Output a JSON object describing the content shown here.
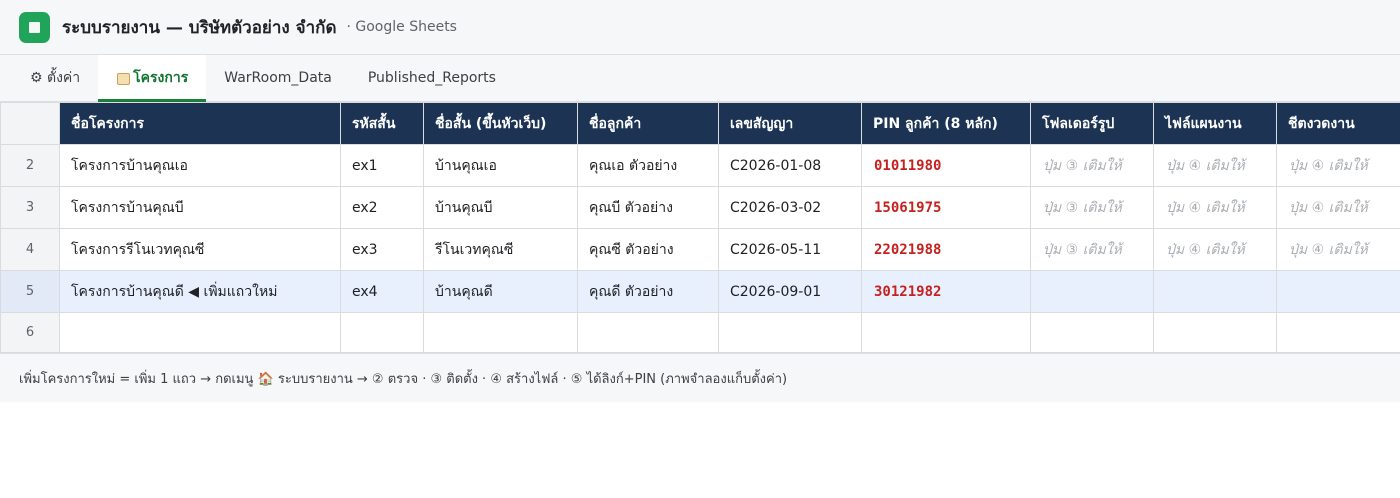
{
  "window": {
    "title": "ระบบรายงาน — บริษัทตัวอย่าง จำกัด",
    "app": "· Google Sheets",
    "brand_color": "#20a45a"
  },
  "tabs": [
    {
      "label": "⚙ ตั้งค่า",
      "active": false
    },
    {
      "label": "โครงการ",
      "icon": "scroll-icon",
      "active": true
    },
    {
      "label": "WarRoom_Data",
      "active": false
    },
    {
      "label": "Published_Reports",
      "active": false
    }
  ],
  "table": {
    "header_color": "#1c3354",
    "columns": [
      "ชื่อโครงการ",
      "รหัสสั้น",
      "ชื่อสั้น (ขึ้นหัวเว็บ)",
      "ชื่อลูกค้า",
      "เลขสัญญา",
      "PIN ลูกค้า (8 หลัก)",
      "โฟลเดอร์รูป",
      "ไฟล์แผนงาน",
      "ชีตงวดงาน"
    ],
    "rows": [
      {
        "num": "2",
        "cells": [
          "โครงการบ้านคุณเอ",
          "ex1",
          "บ้านคุณเอ",
          "คุณเอ ตัวอย่าง",
          "C2026-01-08",
          "01011980",
          "ปุ่ม ③ เติมให้",
          "ปุ่ม ④ เติมให้",
          "ปุ่ม ④ เติมให้"
        ]
      },
      {
        "num": "3",
        "cells": [
          "โครงการบ้านคุณบี",
          "ex2",
          "บ้านคุณบี",
          "คุณบี ตัวอย่าง",
          "C2026-03-02",
          "15061975",
          "ปุ่ม ③ เติมให้",
          "ปุ่ม ④ เติมให้",
          "ปุ่ม ④ เติมให้"
        ]
      },
      {
        "num": "4",
        "cells": [
          "โครงการรีโนเวทคุณซี",
          "ex3",
          "รีโนเวทคุณซี",
          "คุณซี ตัวอย่าง",
          "C2026-05-11",
          "22021988",
          "ปุ่ม ③ เติมให้",
          "ปุ่ม ④ เติมให้",
          "ปุ่ม ④ เติมให้"
        ]
      },
      {
        "num": "5",
        "cells": [
          "โครงการบ้านคุณดี ◀ เพิ่มแถวใหม่",
          "ex4",
          "บ้านคุณดี",
          "คุณดี ตัวอย่าง",
          "C2026-09-01",
          "30121982",
          "",
          "",
          ""
        ]
      },
      {
        "num": "6",
        "cells": [
          "",
          "",
          "",
          "",
          "",
          "",
          "",
          "",
          ""
        ]
      }
    ]
  },
  "footer": {
    "text": "เพิ่มโครงการใหม่ = เพิ่ม 1 แถว → กดเมนู 🏠 ระบบรายงาน → ② ตรวจ · ③ ติดตั้ง · ④ สร้างไฟล์ · ⑤ ได้ลิงก์+PIN (ภาพจำลองแก็บตั้งค่า)"
  }
}
